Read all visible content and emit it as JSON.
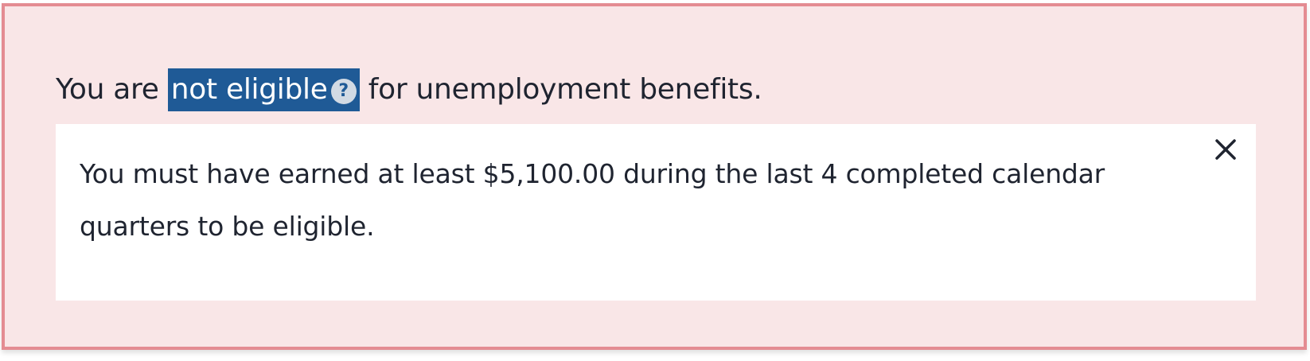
{
  "alert": {
    "prefix": "You are",
    "highlight": "not eligible",
    "suffix": "for unemployment benefits.",
    "help_icon": "question-icon"
  },
  "tooltip": {
    "text": "You must have earned at least $5,100.00 during the last 4 completed calendar quarters to be eligible.",
    "close_icon": "close-icon"
  },
  "colors": {
    "alert_background": "#f9e6e7",
    "alert_border": "#e48c92",
    "highlight_background": "#1f5a96",
    "text": "#1f2430"
  }
}
